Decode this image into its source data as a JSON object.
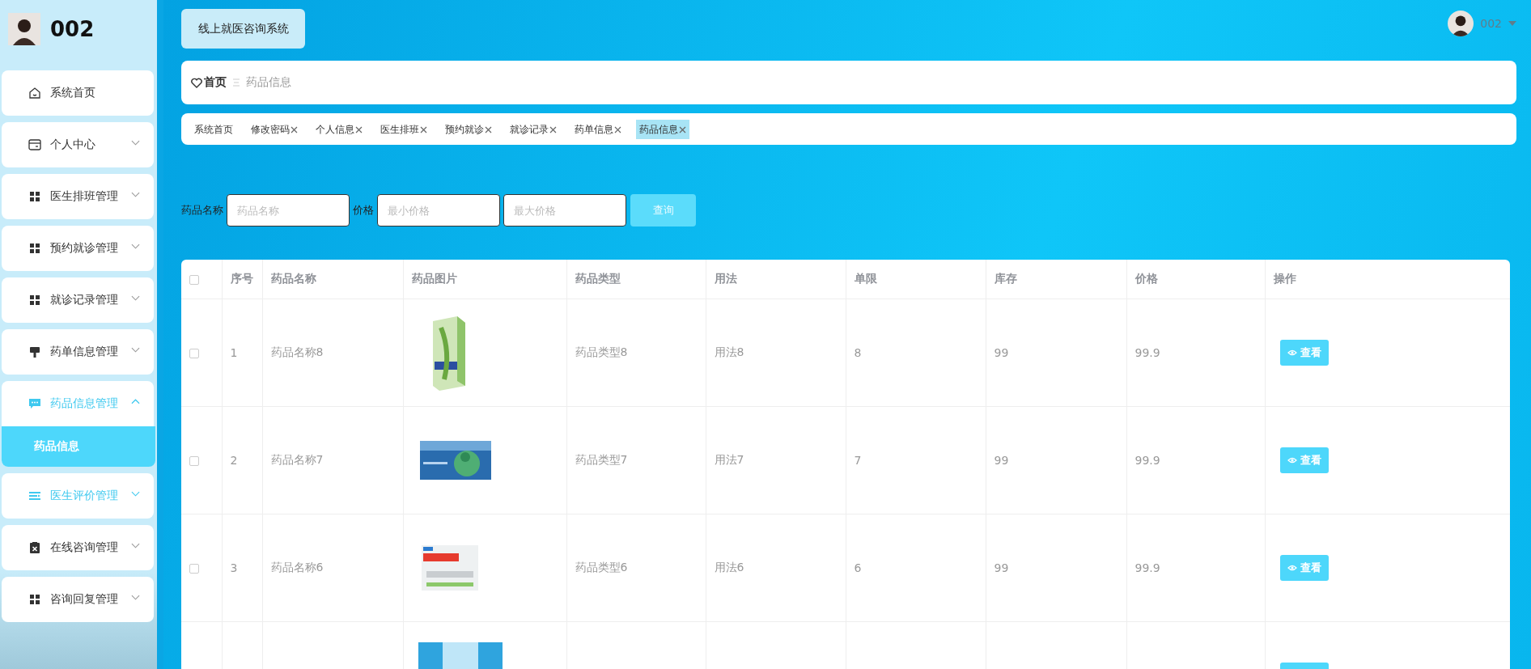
{
  "sidebar": {
    "user": "002",
    "items": [
      {
        "label": "系统首页"
      },
      {
        "label": "个人中心",
        "expanded": false,
        "hovered": false
      },
      {
        "label": "医生排班管理",
        "expanded": false,
        "hovered": false
      },
      {
        "label": "预约就诊管理",
        "expanded": false,
        "hovered": false
      },
      {
        "label": "就诊记录管理",
        "expanded": false,
        "hovered": false
      },
      {
        "label": "药单信息管理",
        "expanded": false,
        "hovered": false
      },
      {
        "label": "药品信息管理",
        "expanded": true,
        "hovered": false,
        "children": [
          {
            "label": "药品信息",
            "selected": true
          }
        ]
      },
      {
        "label": "医生评价管理",
        "expanded": false,
        "hovered": true
      },
      {
        "label": "在线咨询管理",
        "expanded": false,
        "hovered": false
      },
      {
        "label": "咨询回复管理",
        "expanded": false,
        "hovered": false
      }
    ]
  },
  "header": {
    "title": "线上就医咨询系统",
    "user": "002"
  },
  "breadcrumb": {
    "home": "首页",
    "current": "药品信息"
  },
  "tags": [
    {
      "label": "系统首页",
      "closable": false,
      "selected": false
    },
    {
      "label": "修改密码",
      "closable": true,
      "selected": false
    },
    {
      "label": "个人信息",
      "closable": true,
      "selected": false
    },
    {
      "label": "医生排班",
      "closable": true,
      "selected": false
    },
    {
      "label": "预约就诊",
      "closable": true,
      "selected": false
    },
    {
      "label": "就诊记录",
      "closable": true,
      "selected": false
    },
    {
      "label": "药单信息",
      "closable": true,
      "selected": false
    },
    {
      "label": "药品信息",
      "closable": true,
      "selected": true
    }
  ],
  "search": {
    "name_label": "药品名称",
    "name_placeholder": "药品名称",
    "price_label": "价格",
    "min_placeholder": "最小价格",
    "max_placeholder": "最大价格",
    "button": "查询"
  },
  "table": {
    "all_selected": false,
    "columns": [
      "序号",
      "药品名称",
      "药品图片",
      "药品类型",
      "用法",
      "单限",
      "库存",
      "价格",
      "操作"
    ],
    "rows": [
      {
        "selected": false,
        "cells": [
          "1",
          "药品名称8",
          "药品类型8",
          "用法8",
          "8",
          "99",
          "99.9"
        ],
        "action": "查看",
        "image": {
          "kind": "picture"
        }
      },
      {
        "selected": false,
        "cells": [
          "2",
          "药品名称7",
          "药品类型7",
          "用法7",
          "7",
          "99",
          "99.9"
        ],
        "action": "查看",
        "image": {
          "kind": "picture"
        }
      },
      {
        "selected": false,
        "cells": [
          "3",
          "药品名称6",
          "药品类型6",
          "用法6",
          "6",
          "99",
          "99.9"
        ],
        "action": "查看",
        "image": {
          "kind": "picture"
        }
      },
      {
        "image": {
          "kind": "picture"
        }
      }
    ]
  }
}
